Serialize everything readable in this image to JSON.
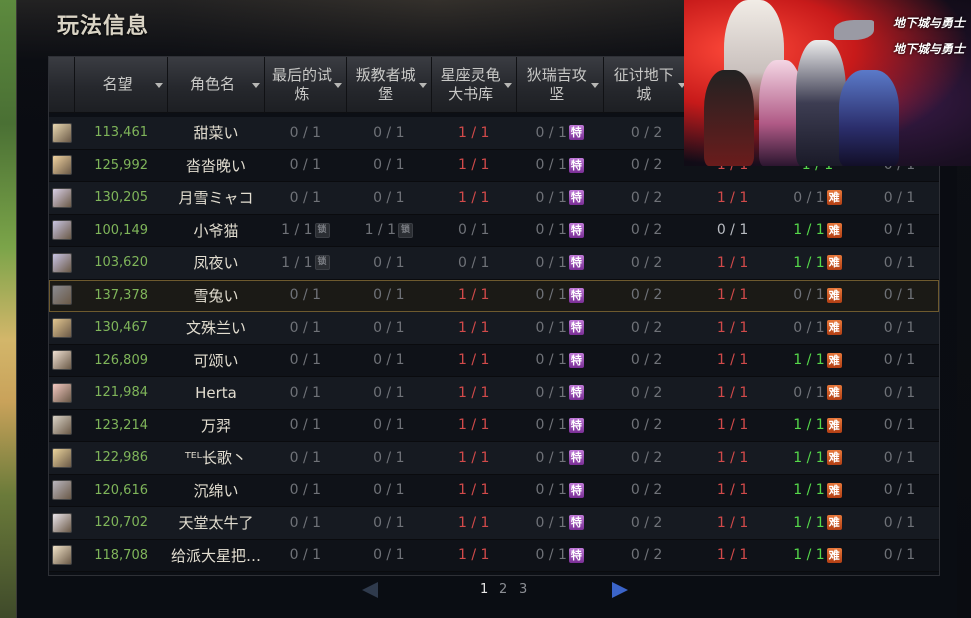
{
  "panel": {
    "title": "玩法信息"
  },
  "columns": [
    {
      "label": "",
      "sortable": false
    },
    {
      "label": "名望",
      "sortable": true
    },
    {
      "label": "角色名",
      "sortable": true
    },
    {
      "label": "最后的试炼",
      "sortable": true
    },
    {
      "label": "叛教者城堡",
      "sortable": true
    },
    {
      "label": "星座灵龟大书库",
      "sortable": true
    },
    {
      "label": "狄瑞吉攻坚",
      "sortable": true
    },
    {
      "label": "征讨地下城",
      "sortable": true
    },
    {
      "label": "",
      "sortable": false
    },
    {
      "label": "",
      "sortable": false
    },
    {
      "label": "",
      "sortable": false
    }
  ],
  "header_labels": {
    "fame": "名望",
    "name": "角色名",
    "t1": "最后的试\n炼",
    "t2": "叛教者城\n堡",
    "t3": "星座灵龟\n大书库",
    "t4": "狄瑞吉攻\n坚",
    "t5": "征讨地下\n城"
  },
  "badges": {
    "purple": "特",
    "orange": "难",
    "lock": "锁"
  },
  "colors": {
    "fame": "#7fb55a",
    "cleared": "#d24a4a",
    "done": "#55d84a",
    "purple_badge": "#9c4dbb",
    "orange_badge": "#d0562a",
    "selected_border": "#6e5a2e"
  },
  "rows": [
    {
      "avatar_color": "#e8d7b0",
      "fame": "113,461",
      "name": "甜菜い",
      "t1": "0 / 1",
      "t1_lock": false,
      "t2": "0 / 1",
      "t2_lock": false,
      "t3": "1 / 1",
      "t3_c": "red",
      "t4": "0 / 1",
      "t5": "0 / 2",
      "t6": "",
      "t6_c": "",
      "t7": "",
      "t7_c": "",
      "t7_badge": false,
      "t8": ""
    },
    {
      "avatar_color": "#f0d2a0",
      "fame": "125,992",
      "name": "沓沓晚い",
      "t1": "0 / 1",
      "t1_lock": false,
      "t2": "0 / 1",
      "t2_lock": false,
      "t3": "1 / 1",
      "t3_c": "red",
      "t4": "0 / 1",
      "t5": "0 / 2",
      "t6": "1 / 1",
      "t6_c": "red",
      "t7": "1 / 1",
      "t7_c": "green",
      "t7_badge": false,
      "t8": "0 / 1"
    },
    {
      "avatar_color": "#d8cfe6",
      "fame": "130,205",
      "name": "月雪ミャコ",
      "t1": "0 / 1",
      "t1_lock": false,
      "t2": "0 / 1",
      "t2_lock": false,
      "t3": "1 / 1",
      "t3_c": "red",
      "t4": "0 / 1",
      "t5": "0 / 2",
      "t6": "1 / 1",
      "t6_c": "red",
      "t7": "0 / 1",
      "t7_c": "",
      "t7_badge": true,
      "t8": "0 / 1"
    },
    {
      "avatar_color": "#c8c4e0",
      "fame": "100,149",
      "name": "小爷猫",
      "t1": "1 / 1",
      "t1_lock": true,
      "t2": "1 / 1",
      "t2_lock": true,
      "t3": "0 / 1",
      "t3_c": "",
      "t4": "0 / 1",
      "t5": "0 / 2",
      "t6": "0 / 1",
      "t6_c": "white",
      "t7": "1 / 1",
      "t7_c": "green",
      "t7_badge": true,
      "t8": "0 / 1"
    },
    {
      "avatar_color": "#c7c3e4",
      "fame": "103,620",
      "name": "凤夜い",
      "t1": "1 / 1",
      "t1_lock": true,
      "t2": "0 / 1",
      "t2_lock": false,
      "t3": "0 / 1",
      "t3_c": "",
      "t4": "0 / 1",
      "t5": "0 / 2",
      "t6": "1 / 1",
      "t6_c": "red",
      "t7": "1 / 1",
      "t7_c": "green",
      "t7_badge": true,
      "t8": "0 / 1"
    },
    {
      "avatar_color": "#8a8a90",
      "fame": "137,378",
      "name": "雪兔い",
      "t1": "0 / 1",
      "t1_lock": false,
      "t2": "0 / 1",
      "t2_lock": false,
      "t3": "1 / 1",
      "t3_c": "red",
      "t4": "0 / 1",
      "t5": "0 / 2",
      "t6": "1 / 1",
      "t6_c": "red",
      "t7": "0 / 1",
      "t7_c": "",
      "t7_badge": true,
      "t8": "0 / 1"
    },
    {
      "avatar_color": "#e2c690",
      "fame": "130,467",
      "name": "文殊兰い",
      "t1": "0 / 1",
      "t1_lock": false,
      "t2": "0 / 1",
      "t2_lock": false,
      "t3": "1 / 1",
      "t3_c": "red",
      "t4": "0 / 1",
      "t5": "0 / 2",
      "t6": "1 / 1",
      "t6_c": "red",
      "t7": "0 / 1",
      "t7_c": "",
      "t7_badge": true,
      "t8": "0 / 1"
    },
    {
      "avatar_color": "#efe0d2",
      "fame": "126,809",
      "name": "可颂い",
      "t1": "0 / 1",
      "t1_lock": false,
      "t2": "0 / 1",
      "t2_lock": false,
      "t3": "1 / 1",
      "t3_c": "red",
      "t4": "0 / 1",
      "t5": "0 / 2",
      "t6": "1 / 1",
      "t6_c": "red",
      "t7": "1 / 1",
      "t7_c": "green",
      "t7_badge": true,
      "t8": "0 / 1"
    },
    {
      "avatar_color": "#f2c7c0",
      "fame": "121,984",
      "name": "Herta",
      "t1": "0 / 1",
      "t1_lock": false,
      "t2": "0 / 1",
      "t2_lock": false,
      "t3": "1 / 1",
      "t3_c": "red",
      "t4": "0 / 1",
      "t5": "0 / 2",
      "t6": "1 / 1",
      "t6_c": "red",
      "t7": "0 / 1",
      "t7_c": "",
      "t7_badge": true,
      "t8": "0 / 1"
    },
    {
      "avatar_color": "#d9d2c6",
      "fame": "123,214",
      "name": "万羿",
      "t1": "0 / 1",
      "t1_lock": false,
      "t2": "0 / 1",
      "t2_lock": false,
      "t3": "1 / 1",
      "t3_c": "red",
      "t4": "0 / 1",
      "t5": "0 / 2",
      "t6": "1 / 1",
      "t6_c": "red",
      "t7": "1 / 1",
      "t7_c": "green",
      "t7_badge": true,
      "t8": "0 / 1"
    },
    {
      "avatar_color": "#ead39c",
      "fame": "122,986",
      "name": "ᵀᴱᴸ长歌丶",
      "t1": "0 / 1",
      "t1_lock": false,
      "t2": "0 / 1",
      "t2_lock": false,
      "t3": "1 / 1",
      "t3_c": "red",
      "t4": "0 / 1",
      "t5": "0 / 2",
      "t6": "1 / 1",
      "t6_c": "red",
      "t7": "1 / 1",
      "t7_c": "green",
      "t7_badge": true,
      "t8": "0 / 1"
    },
    {
      "avatar_color": "#b9b6be",
      "fame": "120,616",
      "name": "沉绵い",
      "t1": "0 / 1",
      "t1_lock": false,
      "t2": "0 / 1",
      "t2_lock": false,
      "t3": "1 / 1",
      "t3_c": "red",
      "t4": "0 / 1",
      "t5": "0 / 2",
      "t6": "1 / 1",
      "t6_c": "red",
      "t7": "1 / 1",
      "t7_c": "green",
      "t7_badge": true,
      "t8": "0 / 1"
    },
    {
      "avatar_color": "#e9e4ea",
      "fame": "120,702",
      "name": "天堂太牛了",
      "t1": "0 / 1",
      "t1_lock": false,
      "t2": "0 / 1",
      "t2_lock": false,
      "t3": "1 / 1",
      "t3_c": "red",
      "t4": "0 / 1",
      "t5": "0 / 2",
      "t6": "1 / 1",
      "t6_c": "red",
      "t7": "1 / 1",
      "t7_c": "green",
      "t7_badge": true,
      "t8": "0 / 1"
    },
    {
      "avatar_color": "#f1e3c8",
      "fame": "118,708",
      "name": "给派大星把…",
      "t1": "0 / 1",
      "t1_lock": false,
      "t2": "0 / 1",
      "t2_lock": false,
      "t3": "1 / 1",
      "t3_c": "red",
      "t4": "0 / 1",
      "t5": "0 / 2",
      "t6": "1 / 1",
      "t6_c": "red",
      "t7": "1 / 1",
      "t7_c": "green",
      "t7_badge": true,
      "t8": "0 / 1"
    }
  ],
  "selected_row": 5,
  "pagination": {
    "pages": [
      "1",
      "2",
      "3"
    ],
    "current": "1"
  },
  "promo": {
    "logo_top": "地下城与勇士",
    "logo_bottom": "地下城与勇士"
  }
}
